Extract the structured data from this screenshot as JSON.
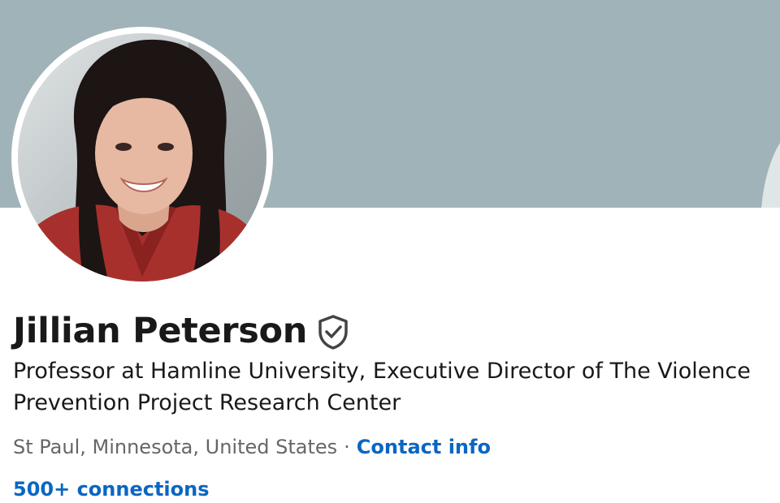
{
  "profile": {
    "name": "Jillian Peterson",
    "verified_icon": "verified-shield-icon",
    "headline": "Professor at Hamline University, Executive Director of The Violence Prevention Project Research Center",
    "location": "St Paul, Minnesota, United States",
    "separator": "·",
    "contact_label": "Contact info",
    "connections_label": "500+ connections"
  },
  "colors": {
    "banner": "#a0b3b8",
    "link": "#0a66c2",
    "text_primary": "#191919",
    "text_secondary": "#666666"
  }
}
